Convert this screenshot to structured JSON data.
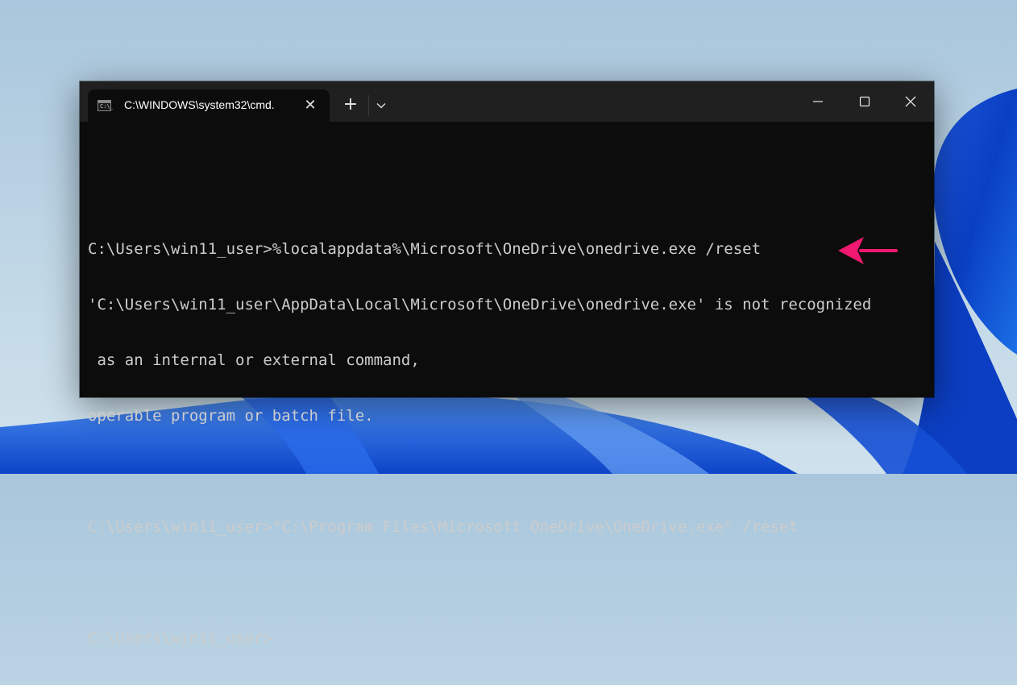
{
  "window": {
    "tab_title": "C:\\WINDOWS\\system32\\cmd.",
    "tab_icon_glyph": "C:\\_",
    "tab_close_glyph": "✕",
    "new_tab_glyph": "+",
    "dropdown_glyph": "⌄"
  },
  "console": {
    "lines": [
      "",
      "C:\\Users\\win11_user>%localappdata%\\Microsoft\\OneDrive\\onedrive.exe /reset",
      "'C:\\Users\\win11_user\\AppData\\Local\\Microsoft\\OneDrive\\onedrive.exe' is not recognized",
      " as an internal or external command,",
      "operable program or batch file.",
      "",
      "C:\\Users\\win11_user>\"C:\\Program Files\\Microsoft OneDrive\\OneDrive.exe\" /reset",
      "",
      "C:\\Users\\win11_user>"
    ]
  },
  "annotation": {
    "arrow_color": "#f0186f",
    "arrow_icon": "arrow-left-icon"
  },
  "colors": {
    "console_bg": "#0c0c0c",
    "console_text": "#cccccc",
    "titlebar_bg": "#202020"
  }
}
